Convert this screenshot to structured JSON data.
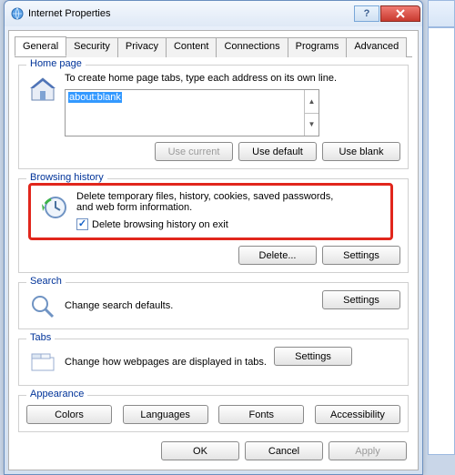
{
  "window": {
    "title": "Internet Properties"
  },
  "tabs": [
    "General",
    "Security",
    "Privacy",
    "Content",
    "Connections",
    "Programs",
    "Advanced"
  ],
  "activeTab": 0,
  "home": {
    "title": "Home page",
    "hint": "To create home page tabs, type each address on its own line.",
    "value": "about:blank",
    "useCurrent": "Use current",
    "useDefault": "Use default",
    "useBlank": "Use blank"
  },
  "history": {
    "title": "Browsing history",
    "desc": "Delete temporary files, history, cookies, saved passwords, and web form information.",
    "checkboxLabel": "Delete browsing history on exit",
    "checkboxChecked": true,
    "delete": "Delete...",
    "settings": "Settings"
  },
  "search": {
    "title": "Search",
    "desc": "Change search defaults.",
    "settings": "Settings"
  },
  "tabsSection": {
    "title": "Tabs",
    "desc": "Change how webpages are displayed in tabs.",
    "settings": "Settings"
  },
  "appearance": {
    "title": "Appearance",
    "colors": "Colors",
    "languages": "Languages",
    "fonts": "Fonts",
    "accessibility": "Accessibility"
  },
  "dialogButtons": {
    "ok": "OK",
    "cancel": "Cancel",
    "apply": "Apply"
  }
}
